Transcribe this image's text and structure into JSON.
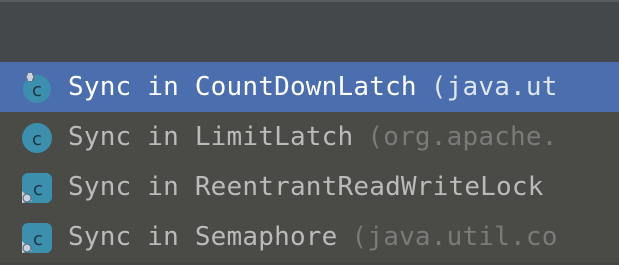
{
  "items": [
    {
      "name": "Sync in CountDownLatch",
      "package": "(java.ut",
      "selected": true,
      "icon": "class-icon"
    },
    {
      "name": "Sync in LimitLatch",
      "package": "(org.apache.",
      "selected": false,
      "icon": "class-icon"
    },
    {
      "name": "Sync in ReentrantReadWriteLock",
      "package": "",
      "selected": false,
      "icon": "abstract-class-icon"
    },
    {
      "name": "Sync in Semaphore",
      "package": "(java.util.co",
      "selected": false,
      "icon": "abstract-class-icon"
    }
  ],
  "colors": {
    "selection": "#4b6eaf",
    "class_icon": "#3d8fae",
    "text": "#bbbbbb",
    "package_text": "#7a7a78"
  }
}
